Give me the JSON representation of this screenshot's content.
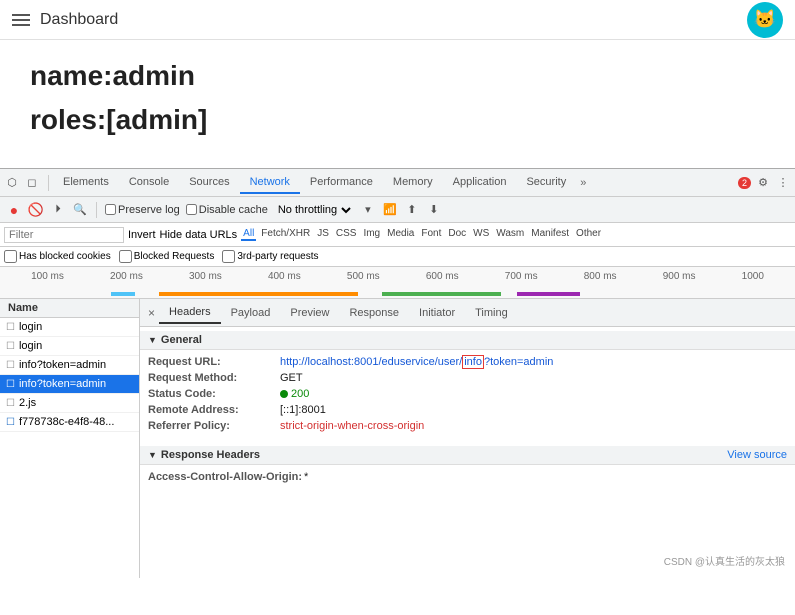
{
  "topbar": {
    "title": "Dashboard",
    "avatar_icon": "🐱"
  },
  "main": {
    "name_line": "name:admin",
    "roles_line": "roles:[admin]"
  },
  "devtools": {
    "tabs": [
      {
        "label": "Elements",
        "active": false
      },
      {
        "label": "Console",
        "active": false
      },
      {
        "label": "Sources",
        "active": false
      },
      {
        "label": "Network",
        "active": true
      },
      {
        "label": "Performance",
        "active": false
      },
      {
        "label": "Memory",
        "active": false
      },
      {
        "label": "Application",
        "active": false
      },
      {
        "label": "Security",
        "active": false
      }
    ],
    "badge_count": "2",
    "network_toolbar": {
      "preserve_log": "Preserve log",
      "disable_cache": "Disable cache",
      "throttle": "No throttling"
    },
    "filter": {
      "placeholder": "Filter",
      "invert": "Invert",
      "hide_data_urls": "Hide data URLs",
      "tags": [
        "All",
        "Fetch/XHR",
        "JS",
        "CSS",
        "Img",
        "Media",
        "Font",
        "Doc",
        "WS",
        "Wasm",
        "Manifest",
        "Other"
      ],
      "active_tag": "All"
    },
    "blocked": {
      "has_blocked_cookies": "Has blocked cookies",
      "blocked_requests": "Blocked Requests",
      "third_party": "3rd-party requests"
    },
    "timeline": {
      "labels": [
        "100 ms",
        "200 ms",
        "300 ms",
        "400 ms",
        "500 ms",
        "600 ms",
        "700 ms",
        "800 ms",
        "900 ms",
        "1000"
      ]
    },
    "file_list": {
      "header": "Name",
      "items": [
        {
          "name": "login",
          "type": "doc",
          "selected": false
        },
        {
          "name": "login",
          "type": "doc",
          "selected": false
        },
        {
          "name": "info?token=admin",
          "type": "doc",
          "selected": false
        },
        {
          "name": "info?token=admin",
          "type": "doc",
          "selected": true
        },
        {
          "name": "2.js",
          "type": "js",
          "selected": false
        },
        {
          "name": "f778738c-e4f8-48...",
          "type": "img",
          "selected": false
        }
      ]
    },
    "request_tabs": [
      "×",
      "Headers",
      "Payload",
      "Preview",
      "Response",
      "Initiator",
      "Timing"
    ],
    "general": {
      "section_title": "General",
      "request_url_label": "Request URL:",
      "request_url_prefix": "http://localhost:8001/eduservice/user/",
      "request_url_highlight": "info",
      "request_url_suffix": "?token=admin",
      "request_method_label": "Request Method:",
      "request_method_value": "GET",
      "status_code_label": "Status Code:",
      "status_code_value": "200",
      "remote_address_label": "Remote Address:",
      "remote_address_value": "[::1]:8001",
      "referrer_policy_label": "Referrer Policy:",
      "referrer_policy_value": "strict-origin-when-cross-origin"
    },
    "response_headers": {
      "section_title": "Response Headers",
      "view_source": "View source",
      "access_control_label": "Access-Control-Allow-Origin:",
      "access_control_value": "*"
    }
  },
  "watermark": "CSDN @认真生活的灰太狼"
}
